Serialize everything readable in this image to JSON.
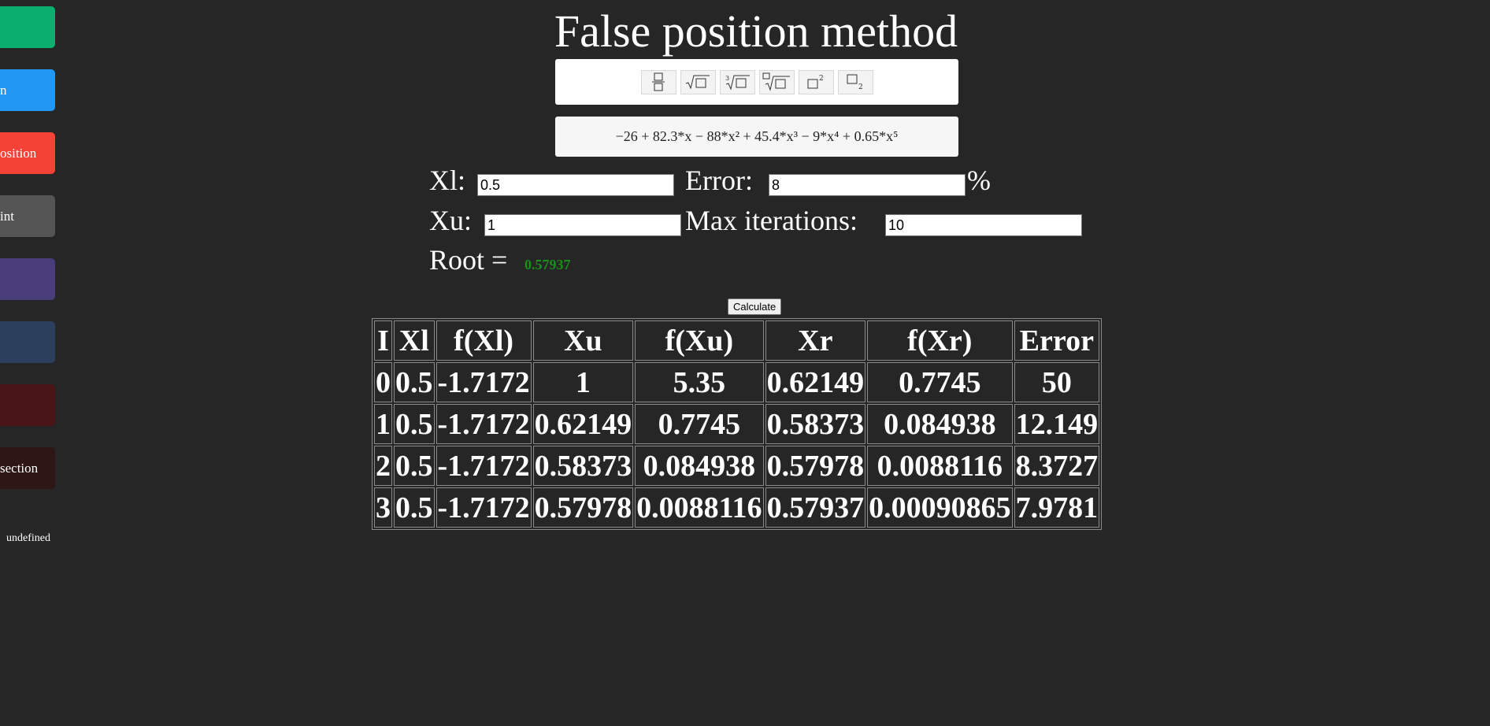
{
  "sidebar": {
    "items": [
      {
        "label": "",
        "color": "#0baf6f"
      },
      {
        "label": "n",
        "color": "#2196f3"
      },
      {
        "label": "osition",
        "color": "#f44336"
      },
      {
        "label": "int",
        "color": "#555555"
      },
      {
        "label": "",
        "color": "#483d7a"
      },
      {
        "label": "",
        "color": "#2c3f5c"
      },
      {
        "label": "",
        "color": "#4a1516"
      },
      {
        "label": "section",
        "color": "#2d1615"
      }
    ],
    "footer_text": "undefined"
  },
  "page_title": "False position method",
  "math_toolbar": {
    "buttons": [
      "fraction-icon",
      "square-root-icon",
      "cube-root-icon",
      "nth-root-icon",
      "superscript-icon",
      "subscript-icon"
    ]
  },
  "formula": "−26 + 82.3*x − 88*x² + 45.4*x³ − 9*x⁴ + 0.65*x⁵",
  "form": {
    "xl_label": "Xl:",
    "xl_value": "0.5",
    "error_label": "Error:",
    "error_value": "8",
    "percent_sign": "%",
    "xu_label": "Xu:",
    "xu_value": "1",
    "max_iter_label": "Max iterations:",
    "max_iter_value": "10",
    "root_label": "Root =",
    "root_value": "0.57937"
  },
  "calculate_label": "Calculate",
  "table": {
    "headers": [
      "I",
      "Xl",
      "f(Xl)",
      "Xu",
      "f(Xu)",
      "Xr",
      "f(Xr)",
      "Error"
    ],
    "rows": [
      [
        "0",
        "0.5",
        "-1.7172",
        "1",
        "5.35",
        "0.62149",
        "0.7745",
        "50"
      ],
      [
        "1",
        "0.5",
        "-1.7172",
        "0.62149",
        "0.7745",
        "0.58373",
        "0.084938",
        "12.149"
      ],
      [
        "2",
        "0.5",
        "-1.7172",
        "0.58373",
        "0.084938",
        "0.57978",
        "0.0088116",
        "8.3727"
      ],
      [
        "3",
        "0.5",
        "-1.7172",
        "0.57978",
        "0.0088116",
        "0.57937",
        "0.00090865",
        "7.9781"
      ]
    ]
  },
  "colors": {
    "background": "#262626",
    "root_value": "#1a8f1a"
  }
}
